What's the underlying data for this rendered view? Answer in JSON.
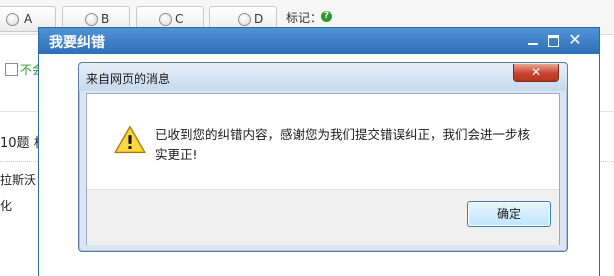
{
  "background": {
    "options": [
      {
        "label": "A"
      },
      {
        "label": "B"
      },
      {
        "label": "C"
      },
      {
        "label": "D"
      }
    ],
    "mark_label": "标记：",
    "unsure_label": "不会",
    "question_prefix": "10题",
    "question_suffix": "相",
    "line1_fragment": "拉斯沃",
    "line2_fragment": "化",
    "accent_green": "#2e9a2e"
  },
  "outer_dialog": {
    "title": "我要纠错",
    "title_bar_color": "#3a7cc3"
  },
  "alert": {
    "title": "来自网页的消息",
    "close_icon": "close-icon",
    "icon": "warning-icon",
    "message": "已收到您的纠错内容，感谢您为我们提交错误纠正，我们会进一步核实更正!",
    "ok_label": "确定"
  }
}
